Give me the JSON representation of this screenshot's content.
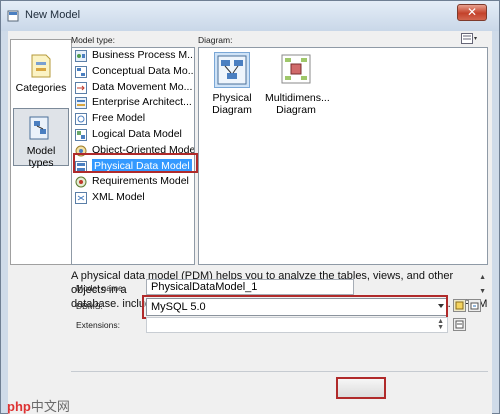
{
  "window": {
    "title": "New Model",
    "close_glyph": "✕"
  },
  "categories": [
    {
      "label": "Categories",
      "icon": "categories-icon",
      "selected": false
    },
    {
      "label": "Model types",
      "icon": "model-types-icon",
      "selected": true
    }
  ],
  "model_type": {
    "header": "Model type:",
    "items": [
      {
        "label": "Business Process M...",
        "icon": "business-process-icon"
      },
      {
        "label": "Conceptual Data Mo...",
        "icon": "conceptual-data-icon"
      },
      {
        "label": "Data Movement Mo...",
        "icon": "data-movement-icon"
      },
      {
        "label": "Enterprise Architect...",
        "icon": "enterprise-architecture-icon"
      },
      {
        "label": "Free Model",
        "icon": "free-model-icon"
      },
      {
        "label": "Logical Data Model",
        "icon": "logical-data-icon"
      },
      {
        "label": "Object-Oriented Model",
        "icon": "object-oriented-icon"
      },
      {
        "label": "Physical Data Model",
        "icon": "physical-data-icon",
        "selected": true
      },
      {
        "label": "Requirements Model",
        "icon": "requirements-icon"
      },
      {
        "label": "XML Model",
        "icon": "xml-model-icon"
      }
    ]
  },
  "diagram": {
    "header": "Diagram:",
    "items": [
      {
        "label_line1": "Physical",
        "label_line2": "Diagram",
        "icon": "physical-diagram-icon",
        "selected": true
      },
      {
        "label_line1": "Multidimens...",
        "label_line2": "Diagram",
        "icon": "multidimensional-diagram-icon",
        "selected": false
      }
    ]
  },
  "description": {
    "line1": "A physical data model (PDM) helps you to analyze the tables, views, and other objects in a",
    "line2": "database, including multidimensional objects necessary for data warehousing. A PDM is"
  },
  "form": {
    "model_name_label": "Model name:",
    "model_name_value": "PhysicalDataModel_1",
    "dbms_label": "DBMS:",
    "dbms_value": "MySQL 5.0",
    "extensions_label": "Extensions:",
    "extensions_value": ""
  },
  "buttons": {
    "ok_label": ""
  },
  "watermark": {
    "brand": "php",
    "text": "中文网"
  },
  "colors": {
    "selection": "#3399ff",
    "highlight_box": "#b02a2a",
    "dialog_bg": "#f0f0f0"
  }
}
